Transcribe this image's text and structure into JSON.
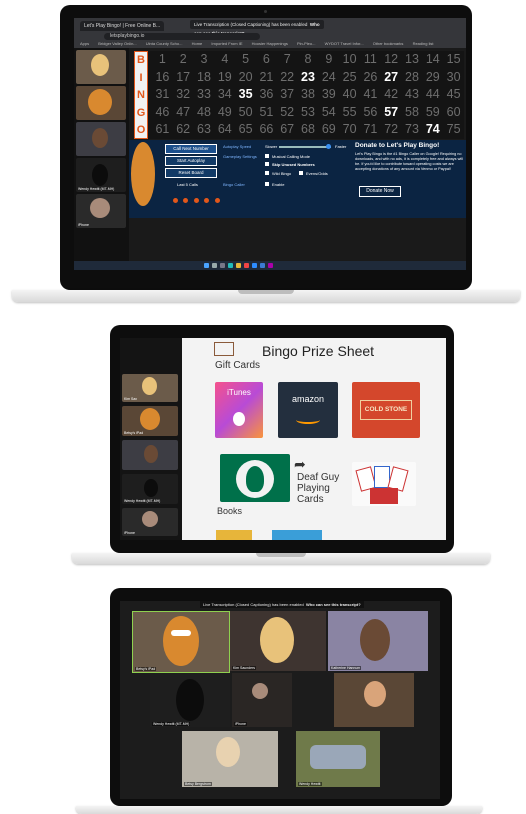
{
  "laptop1": {
    "browser": {
      "tab_title": "Let's Play Bingo! | Free Online B...",
      "url": "letsplaybingo.io",
      "banner": "Live Transcription (Closed Captioning) has been enabled",
      "banner_prompt": "Who can see this transcript?",
      "bookmarks": [
        "Apps",
        "Bridger Valley Onlin...",
        "Uinta County Scho...",
        "Home",
        "Imported From IE",
        "Hoosier Happenings",
        "Pin-Pleo...",
        "WYDOT Travel Infor...",
        "Other bookmarks",
        "Reading list"
      ]
    },
    "bingo_letters": [
      "B",
      "I",
      "N",
      "G",
      "O"
    ],
    "numbers_called": [
      23,
      27,
      35,
      57,
      74
    ],
    "panel": {
      "call_next": "Call Next Number",
      "start_autoplay": "Start Autoplay",
      "reset_board": "Reset Board",
      "last_calls_label": "Last 5 Calls",
      "autoplay_speed": "Autoplay Speed",
      "slower": "Slower",
      "faster": "Faster",
      "gameplay_settings": "Gameplay Settings",
      "musical_calling": "Musical Calling Mode",
      "skip_unused": "Skip Unused Numbers",
      "wild_bingo": "Wild Bingo",
      "evens_odds": "Evens/Odds",
      "bingo_caller": "Bingo Caller",
      "enable": "Enable",
      "donate_title": "Donate to Let's Play Bingo!",
      "donate_text": "Let's Play Bingo is the #1 Bingo Caller on Google! Requiring no downloads, and with no ads, it is completely free and always will be. If you'd like to contribute toward operating costs we are accepting donations of any amount via Venmo or Paypal!",
      "donate_button": "Donate Now"
    },
    "participants": [
      "Wendy Hewitt (MT-MH)",
      "iPhone"
    ]
  },
  "laptop2": {
    "slide_title": "Bingo Prize Sheet",
    "gift_cards_heading": "Gift Cards",
    "cards": {
      "itunes": "iTunes",
      "amazon": "amazon",
      "coldstone": "COLD STONE",
      "deaf_guy": "Deaf Guy Playing Cards"
    },
    "books_heading": "Books",
    "participants": [
      "Kim Sax",
      "Betsy's iPad",
      "Wendy Hewitt (MT-MH)",
      "iPhone"
    ]
  },
  "laptop3": {
    "banner": "Live Transcription (Closed Captioning) has been enabled",
    "banner_prompt": "Who can see this transcript?",
    "participants": [
      "Betsy's iPad",
      "Kim Saunders",
      "Katherine Hannum",
      "Wendy Hewitt (MT-MH)",
      "iPhone",
      "Betsy Bergstrom",
      "Wendy Hewitt"
    ]
  },
  "colors": {
    "brand_orange": "#e2571b",
    "panel_navy": "#0b2442",
    "link_blue": "#7fb6ff"
  }
}
